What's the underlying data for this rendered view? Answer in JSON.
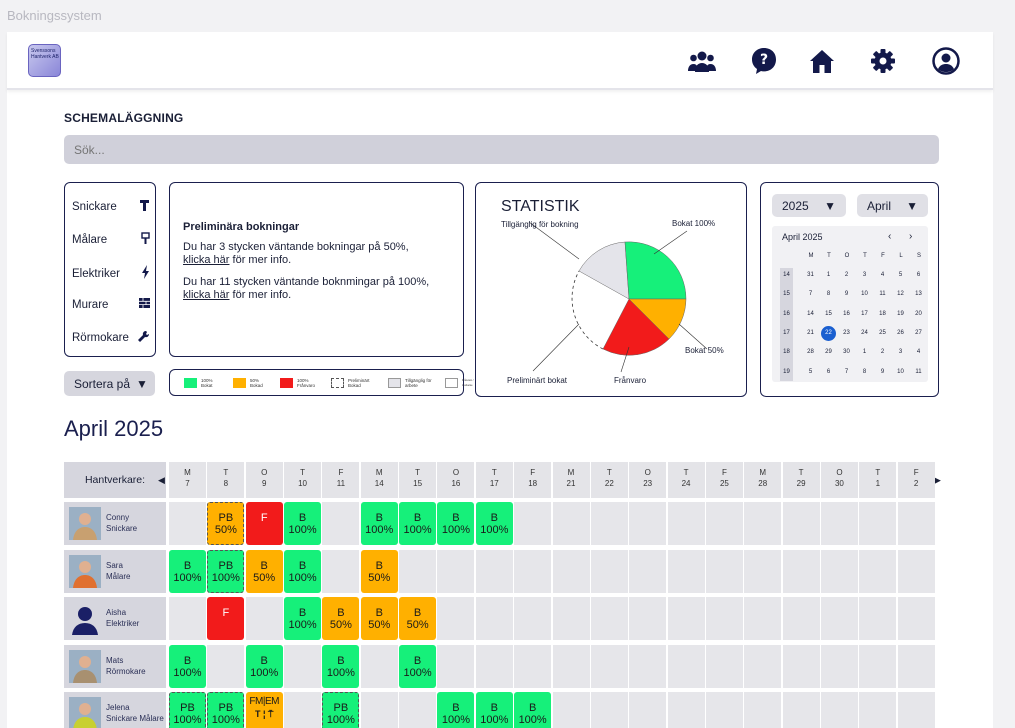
{
  "window_title": "Bokningssystem",
  "logo_text": "Svenssons Hantverk AB",
  "nav": {
    "icons": [
      "people-icon",
      "help-icon",
      "home-icon",
      "settings-icon",
      "account-icon"
    ]
  },
  "section_title": "SCHEMALÄGGNING",
  "search": {
    "placeholder": "Sök..."
  },
  "trades": [
    {
      "label": "Snickare",
      "icon": "hammer-icon"
    },
    {
      "label": "Målare",
      "icon": "paintbrush-icon"
    },
    {
      "label": "Elektriker",
      "icon": "lightning-icon"
    },
    {
      "label": "Murare",
      "icon": "brick-icon"
    },
    {
      "label": "Rörmokare",
      "icon": "wrench-icon"
    }
  ],
  "sort_label": "Sortera på",
  "preliminary": {
    "title": "Preliminära bokningar",
    "msg1": "Du har 3 stycken väntande bokningar på 50%,",
    "link1": "klicka här",
    "msg1_tail": " för mer info.",
    "msg2": "Du har 11 stycken väntande boknmingar på 100%,",
    "link2": "klicka här",
    "msg2_tail": " för mer info."
  },
  "legend": [
    {
      "label": "100% Bokat",
      "color": "#16f07a"
    },
    {
      "label": "50% Bokad",
      "color": "#ffb000"
    },
    {
      "label": "100% Frånvaro",
      "color": "#f21b1b"
    },
    {
      "label": "Preliminärt Bokad",
      "color": "dashed"
    },
    {
      "label": "Tillgänglig för arbete",
      "color": "#e4e4ea"
    },
    {
      "label": "Frånvaro / Avvikelse",
      "color": "mini"
    }
  ],
  "stats": {
    "title": "STATISTIK",
    "labels": {
      "available": "Tillgänglig för bokning",
      "booked100": "Bokat 100%",
      "booked50": "Bokat 50%",
      "absence": "Frånvaro",
      "prelim": "Preliminärt bokat"
    }
  },
  "calendar": {
    "year": "2025",
    "month": "April",
    "header": "April 2025",
    "weekdays": [
      "M",
      "T",
      "O",
      "T",
      "F",
      "L",
      "S"
    ],
    "weeks": [
      {
        "wk": "14",
        "days": [
          "31",
          "1",
          "2",
          "3",
          "4",
          "5",
          "6"
        ]
      },
      {
        "wk": "15",
        "days": [
          "7",
          "8",
          "9",
          "10",
          "11",
          "12",
          "13"
        ]
      },
      {
        "wk": "16",
        "days": [
          "14",
          "15",
          "16",
          "17",
          "18",
          "19",
          "20"
        ]
      },
      {
        "wk": "17",
        "days": [
          "21",
          "22",
          "23",
          "24",
          "25",
          "26",
          "27"
        ]
      },
      {
        "wk": "18",
        "days": [
          "28",
          "29",
          "30",
          "1",
          "2",
          "3",
          "4"
        ]
      },
      {
        "wk": "19",
        "days": [
          "5",
          "6",
          "7",
          "8",
          "9",
          "10",
          "11"
        ]
      }
    ],
    "selected": "22"
  },
  "schedule": {
    "month_title": "April 2025",
    "header_label": "Hantverkare:",
    "days": [
      {
        "d": "M",
        "n": "7"
      },
      {
        "d": "T",
        "n": "8"
      },
      {
        "d": "O",
        "n": "9"
      },
      {
        "d": "T",
        "n": "10"
      },
      {
        "d": "F",
        "n": "11"
      },
      {
        "d": "M",
        "n": "14"
      },
      {
        "d": "T",
        "n": "15"
      },
      {
        "d": "O",
        "n": "16"
      },
      {
        "d": "T",
        "n": "17"
      },
      {
        "d": "F",
        "n": "18"
      },
      {
        "d": "M",
        "n": "21"
      },
      {
        "d": "T",
        "n": "22"
      },
      {
        "d": "O",
        "n": "23"
      },
      {
        "d": "T",
        "n": "24"
      },
      {
        "d": "F",
        "n": "25"
      },
      {
        "d": "M",
        "n": "28"
      },
      {
        "d": "T",
        "n": "29"
      },
      {
        "d": "O",
        "n": "30"
      },
      {
        "d": "T",
        "n": "1"
      },
      {
        "d": "F",
        "n": "2"
      }
    ],
    "people": [
      {
        "name": "Conny",
        "role": "Snickare",
        "bookings": [
          null,
          {
            "t": "PB",
            "v": "50%",
            "c": "o"
          },
          {
            "t": "F",
            "v": "",
            "c": "r"
          },
          {
            "t": "B",
            "v": "100%",
            "c": "g"
          },
          null,
          {
            "t": "B",
            "v": "100%",
            "c": "g"
          },
          {
            "t": "B",
            "v": "100%",
            "c": "g"
          },
          {
            "t": "B",
            "v": "100%",
            "c": "g"
          },
          {
            "t": "B",
            "v": "100%",
            "c": "g"
          }
        ]
      },
      {
        "name": "Sara",
        "role": "Målare",
        "bookings": [
          {
            "t": "B",
            "v": "100%",
            "c": "g"
          },
          {
            "t": "PB",
            "v": "100%",
            "c": "g"
          },
          {
            "t": "B",
            "v": "50%",
            "c": "o"
          },
          {
            "t": "B",
            "v": "100%",
            "c": "g"
          },
          null,
          {
            "t": "B",
            "v": "50%",
            "c": "o"
          }
        ]
      },
      {
        "name": "Aisha",
        "role": "Elektriker",
        "bookings": [
          null,
          {
            "t": "F",
            "v": "",
            "c": "r"
          },
          null,
          {
            "t": "B",
            "v": "100%",
            "c": "g"
          },
          {
            "t": "B",
            "v": "50%",
            "c": "o"
          },
          {
            "t": "B",
            "v": "50%",
            "c": "o"
          },
          {
            "t": "B",
            "v": "50%",
            "c": "o"
          }
        ]
      },
      {
        "name": "Mats",
        "role": "Rörmokare",
        "bookings": [
          {
            "t": "B",
            "v": "100%",
            "c": "g"
          },
          null,
          {
            "t": "B",
            "v": "100%",
            "c": "g"
          },
          null,
          {
            "t": "B",
            "v": "100%",
            "c": "g"
          },
          null,
          {
            "t": "B",
            "v": "100%",
            "c": "g"
          }
        ]
      },
      {
        "name": "Jelena",
        "role": "Snickare Målare",
        "bookings": [
          {
            "t": "PB",
            "v": "100%",
            "c": "g"
          },
          {
            "t": "PB",
            "v": "100%",
            "c": "g"
          },
          {
            "t": "FM|EM",
            "v": "",
            "c": "o"
          },
          null,
          {
            "t": "PB",
            "v": "100%",
            "c": "g"
          },
          null,
          null,
          {
            "t": "B",
            "v": "100%",
            "c": "g"
          },
          {
            "t": "B",
            "v": "100%",
            "c": "g"
          },
          {
            "t": "B",
            "v": "100%",
            "c": "g"
          }
        ]
      }
    ]
  }
}
